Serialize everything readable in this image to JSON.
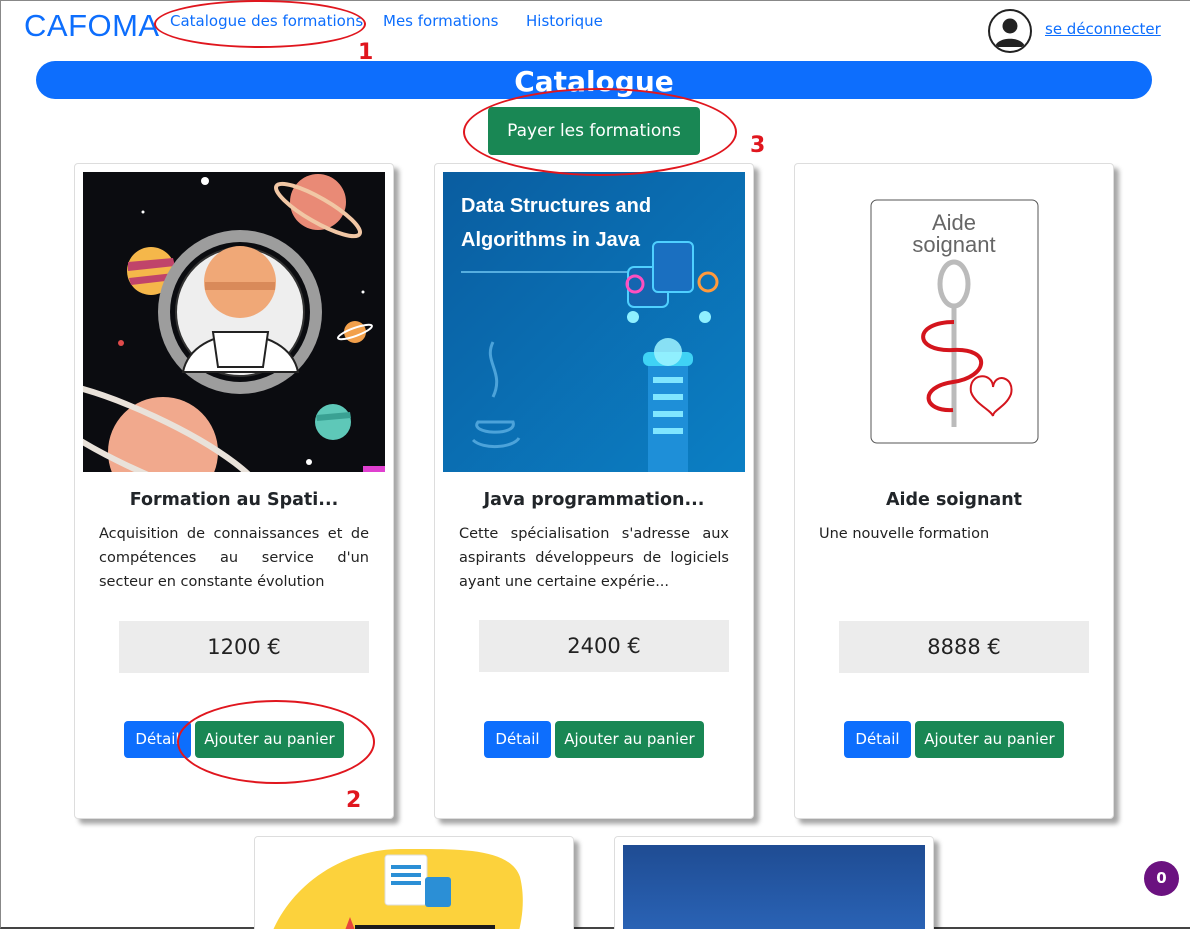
{
  "navbar": {
    "brand": "CAFOMA",
    "links": [
      "Catalogue des formations",
      "Mes formations",
      "Historique"
    ],
    "logout_label": "se déconnecter"
  },
  "banner": {
    "title": "Catalogue"
  },
  "pay_button_label": "Payer les formations",
  "cards": [
    {
      "title": "Formation au Spati...",
      "image_text": "",
      "description": "Acquisition de connaissances et de compétences au service d'un secteur en constante évolution",
      "price": "1200 €",
      "detail_label": "Détail",
      "add_label": "Ajouter au panier"
    },
    {
      "title": "Java programmation...",
      "image_text": "Data Structures and Algorithms in Java",
      "description": "Cette spécialisation s'adresse aux aspirants développeurs de logiciels ayant une certaine expérie...",
      "price": "2400 €",
      "detail_label": "Détail",
      "add_label": "Ajouter au panier"
    },
    {
      "title": "Aide soignant",
      "image_text": "Aide soignant",
      "description": "Une nouvelle formation",
      "price": "8888 €",
      "detail_label": "Détail",
      "add_label": "Ajouter au panier"
    }
  ],
  "annotations": [
    "1",
    "2",
    "3"
  ],
  "notification_count": "0",
  "colors": {
    "primary": "#0d6efd",
    "success": "#198754",
    "annotation": "#e0161e",
    "badge": "#6b1280"
  }
}
